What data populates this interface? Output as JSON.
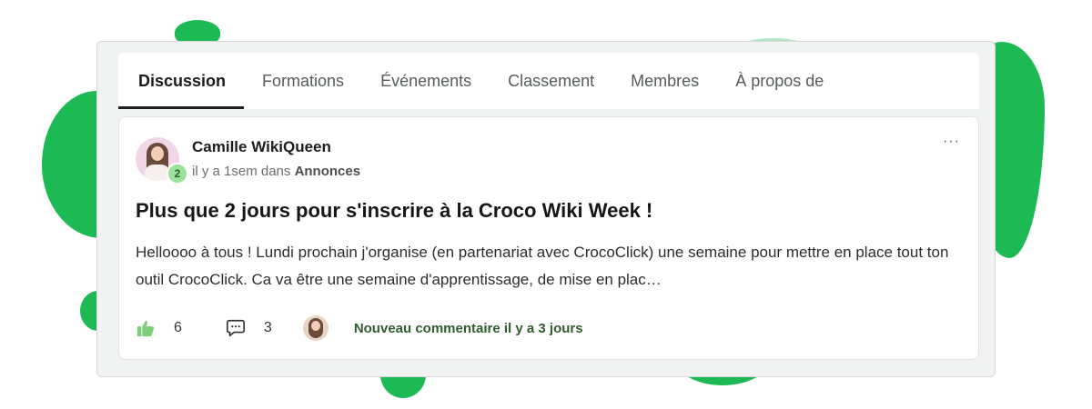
{
  "tabs": [
    {
      "label": "Discussion",
      "active": true
    },
    {
      "label": "Formations"
    },
    {
      "label": "Événements"
    },
    {
      "label": "Classement"
    },
    {
      "label": "Membres"
    },
    {
      "label": "À propos de"
    }
  ],
  "post": {
    "author": "Camille WikiQueen",
    "level": "2",
    "time": "il y a 1sem dans",
    "category": "Annonces",
    "more": "···",
    "title": "Plus que 2 jours pour s'inscrire à la Croco Wiki Week !",
    "excerpt": "Helloooo à tous ! Lundi prochain j'organise (en partenariat avec CrocoClick) une semaine pour mettre en place tout ton outil CrocoClick. Ca va être une semaine d'apprentissage, de mise en plac…",
    "likes": "6",
    "comments": "3",
    "last_comment": "Nouveau commentaire il y a 3 jours"
  },
  "icons": {
    "like": "thumbs-up-icon",
    "comment": "comment-bubble-icon",
    "more": "more-dots-icon"
  },
  "colors": {
    "accent_green": "#1db954",
    "like_green": "#7ccf7a",
    "comment_text_green": "#2f5d2c"
  }
}
